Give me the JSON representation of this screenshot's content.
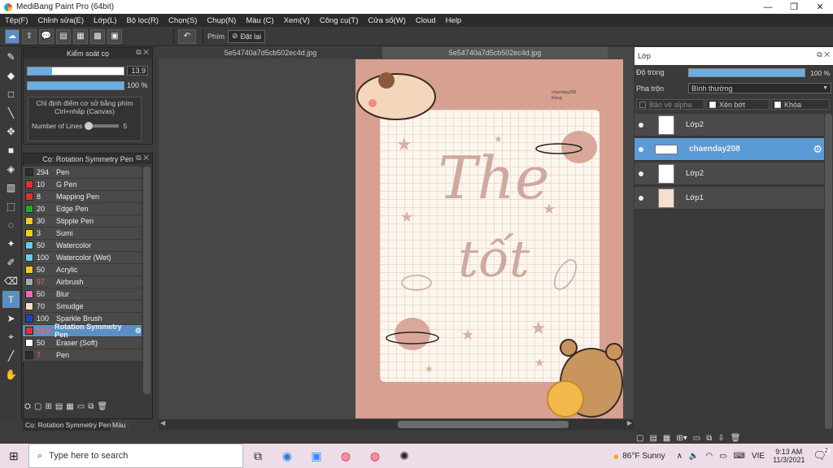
{
  "title_bar": {
    "title": "MediBang Paint Pro (64bit)",
    "minimize": "—",
    "maximize": "❐",
    "close": "✕"
  },
  "menu": [
    "Tệp(F)",
    "Chỉnh sửa(E)",
    "Lớp(L)",
    "Bộ lọc(R)",
    "Chọn(S)",
    "Chụp(N)",
    "Màu (C)",
    "Xem(V)",
    "Công cụ(T)",
    "Cửa sổ(W)",
    "Cloud",
    "Help"
  ],
  "toolbar": {
    "phim_label": "Phím",
    "reset_label": "Đặt lại"
  },
  "brush_control": {
    "title": "Kiểm soát cọ",
    "size_value": "13.9",
    "size_fill": 0.25,
    "opacity_value": "100 %",
    "opacity_fill": 1.0,
    "hint": "Chỉ định điểm cơ sở bằng phím Ctrl+nhấp (Canvas)",
    "lines_label": "Number of Lines",
    "lines_value": "5"
  },
  "brush_panel": {
    "title": "Cọ: Rotation Symmetry Pen",
    "brushes": [
      {
        "size": "294",
        "name": "Pen",
        "color": "#2d2d2d"
      },
      {
        "size": "10",
        "name": "G Pen",
        "color": "#e03030"
      },
      {
        "size": "8",
        "name": "Mapping Pen",
        "color": "#e03030"
      },
      {
        "size": "20",
        "name": "Edge Pen",
        "color": "#22aa22"
      },
      {
        "size": "30",
        "name": "Stipple Pen",
        "color": "#eecc22"
      },
      {
        "size": "3",
        "name": "Sumi",
        "color": "#eecc22"
      },
      {
        "size": "50",
        "name": "Watercolor",
        "color": "#66ccee"
      },
      {
        "size": "100",
        "name": "Watercolor (Wet)",
        "color": "#66ccee"
      },
      {
        "size": "50",
        "name": "Acrylic",
        "color": "#eecc22"
      },
      {
        "size": "97",
        "name": "Airbrush",
        "color": "#aaaaaa"
      },
      {
        "size": "50",
        "name": "Blur",
        "color": "#ee66bb"
      },
      {
        "size": "70",
        "name": "Smudge",
        "color": "#f5dcc8"
      },
      {
        "size": "100",
        "name": "Sparkle Brush",
        "color": "#2244cc"
      },
      {
        "size": "13.9",
        "name": "Rotation Symmetry Pen",
        "color": "#e03030"
      },
      {
        "size": "50",
        "name": "Eraser (Soft)",
        "color": "#ffffff"
      },
      {
        "size": "7",
        "name": "Pen",
        "color": "#2d2d2d"
      }
    ],
    "bottom_tabs": [
      "Cọ: Rotation Symmetry Pen",
      "Màu"
    ]
  },
  "doc_tabs": [
    "5e54740a7d5cb502ec4d.jpg",
    "5e54740a7d5cb502ec4d.jpg"
  ],
  "artwork": {
    "line1": "The",
    "line2": "tốt",
    "note": "chaenday208",
    "note2": "tháng"
  },
  "layer_panel": {
    "title": "Lớp",
    "opacity_label": "Độ trong",
    "opacity_value": "100 %",
    "blend_label": "Pha trộn",
    "blend_value": "Bình thường",
    "protect_alpha": "Bảo vệ alpha",
    "clipping": "Xén bớt",
    "lock": "Khóa",
    "layers": [
      "Lớp2",
      "chaenday208",
      "Lớp2",
      "Lớp1"
    ]
  },
  "taskbar": {
    "search": "Type here to search",
    "weather": "86°F  Sunny",
    "lang": "VIE",
    "time": "9:13 AM",
    "date": "11/3/2021",
    "notif": "2"
  }
}
